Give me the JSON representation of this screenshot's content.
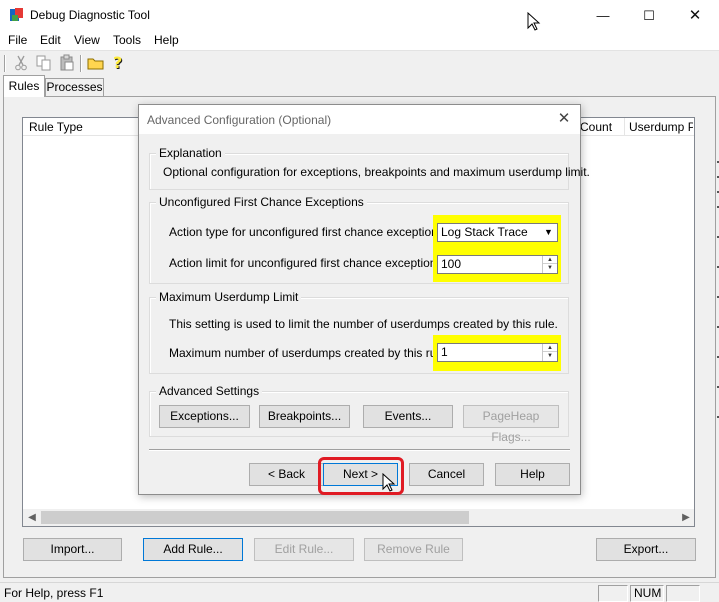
{
  "window": {
    "title": "Debug Diagnostic Tool",
    "minimize": "—",
    "maximize": "☐",
    "close": "✕"
  },
  "menu": {
    "items": [
      "File",
      "Edit",
      "View",
      "Tools",
      "Help"
    ]
  },
  "toolbar": {
    "icons": [
      "cut-icon",
      "copy-icon",
      "paste-icon",
      "folder-icon",
      "help-icon"
    ]
  },
  "tabs": {
    "rules": "Rules",
    "processes": "Processes",
    "active": "Rules"
  },
  "rule_list": {
    "columns": [
      "Rule Type",
      "Count",
      "Userdump Pat"
    ]
  },
  "bottom_buttons": {
    "import": "Import...",
    "add_rule": "Add Rule...",
    "edit_rule": "Edit Rule...",
    "remove_rule": "Remove Rule",
    "export": "Export..."
  },
  "statusbar": {
    "text": "For Help, press F1",
    "num": "NUM"
  },
  "dialog": {
    "title": "Advanced Configuration (Optional)",
    "close": "✕",
    "explanation": {
      "label": "Explanation",
      "text": "Optional configuration for exceptions, breakpoints and maximum userdump limit."
    },
    "first_chance": {
      "label": "Unconfigured First Chance Exceptions",
      "action_type_label": "Action type for unconfigured first chance exceptions:",
      "action_type_value": "Log Stack Trace",
      "action_limit_label": "Action limit for unconfigured first chance exceptions:",
      "action_limit_value": "100"
    },
    "userdump_limit": {
      "label": "Maximum Userdump Limit",
      "text": "This setting is used to limit the number of userdumps created by this rule.",
      "max_label": "Maximum number of userdumps created by this rule:",
      "max_value": "1"
    },
    "advanced": {
      "label": "Advanced Settings",
      "exceptions": "Exceptions...",
      "breakpoints": "Breakpoints...",
      "events": "Events...",
      "pageheap": "PageHeap Flags..."
    },
    "buttons": {
      "back": "< Back",
      "next": "Next >",
      "cancel": "Cancel",
      "help": "Help"
    }
  },
  "colors": {
    "highlight": "#ffff00",
    "next_outline": "#e01b24"
  }
}
